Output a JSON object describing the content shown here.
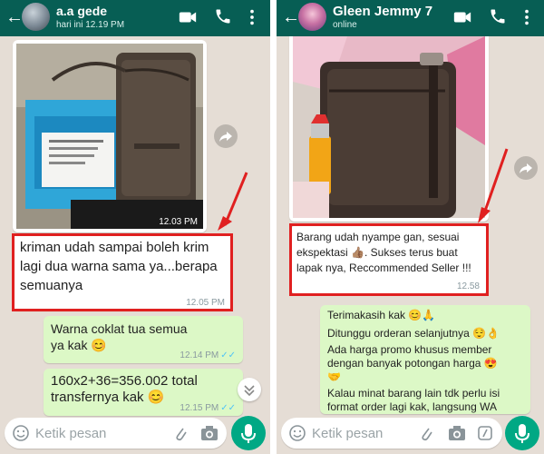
{
  "left": {
    "contact_name": "a.a gede",
    "status": "hari ini 12.19 PM",
    "messages": [
      {
        "type": "image",
        "time": "12.03 PM"
      },
      {
        "type": "text",
        "direction": "in",
        "text": "kriman udah sampai boleh krim lagi dua warna sama ya...berapa semuanya",
        "time": "12.05 PM"
      },
      {
        "type": "text",
        "direction": "out",
        "text": "Warna coklat tua semua ya kak 😊",
        "time": "12.14 PM",
        "ticks": "✓✓"
      },
      {
        "type": "text",
        "direction": "out",
        "text": "160x2+36=356.002 total transfernya kak 😊",
        "time": "12.15 PM",
        "ticks": "✓✓"
      }
    ],
    "input_placeholder": "Ketik pesan"
  },
  "right": {
    "contact_name": "Gleen Jemmy 7",
    "status": "online",
    "messages": [
      {
        "type": "image"
      },
      {
        "type": "text",
        "direction": "in",
        "text": "Barang udah nyampe gan, sesuai ekspektasi 👍🏽. Sukses terus buat lapak nya, Reccommended Seller !!!",
        "time": "12.58"
      },
      {
        "type": "text",
        "direction": "out",
        "lines": [
          "Terimakasih kak 😊🙏",
          "Ditunggu orderan selanjutnya 😌👌",
          "Ada harga promo khusus member dengan banyak potongan harga 😍🤝",
          "Kalau minat barang lain tdk perlu isi format order lagi kak, langsung WA"
        ]
      }
    ],
    "input_placeholder": "Ketik pesan"
  },
  "colors": {
    "header": "#075e54",
    "chat_bg": "#e5ddd5",
    "outgoing": "#dcf8c6",
    "incoming": "#ffffff",
    "accent": "#00a884",
    "highlight": "#e02020"
  },
  "icons": [
    "back-arrow-icon",
    "video-call-icon",
    "phone-icon",
    "more-options-icon",
    "share-icon",
    "emoji-icon",
    "attach-icon",
    "camera-icon",
    "mic-icon",
    "scroll-down-icon",
    "red-arrow-icon"
  ]
}
